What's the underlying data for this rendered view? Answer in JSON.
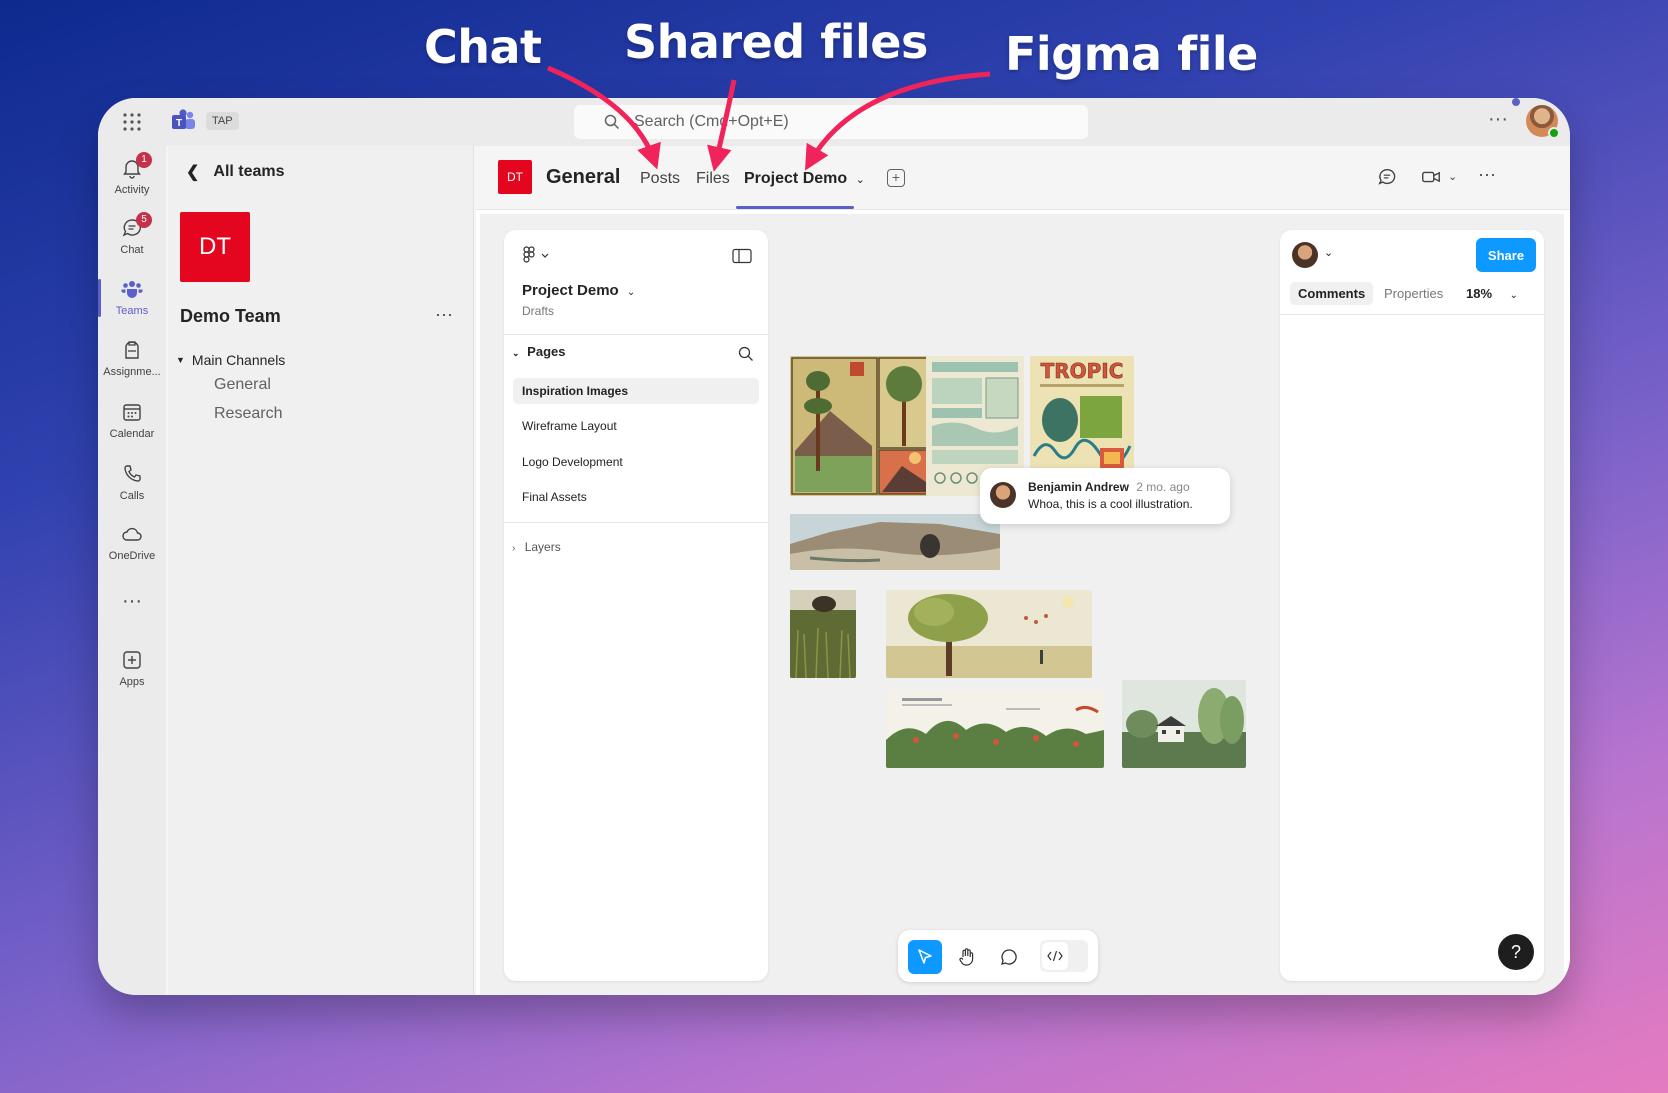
{
  "annotations": {
    "chat": "Chat",
    "shared_files": "Shared files",
    "figma_file": "Figma file"
  },
  "topbar": {
    "tenant": "TAP",
    "search_placeholder": "Search (Cmd+Opt+E)"
  },
  "rail": {
    "items": [
      {
        "label": "Activity",
        "badge": "1",
        "icon": "bell-icon"
      },
      {
        "label": "Chat",
        "badge": "5",
        "icon": "chat-icon"
      },
      {
        "label": "Teams",
        "icon": "teams-icon"
      },
      {
        "label": "Assignme...",
        "icon": "backpack-icon"
      },
      {
        "label": "Calendar",
        "icon": "calendar-icon"
      },
      {
        "label": "Calls",
        "icon": "phone-icon"
      },
      {
        "label": "OneDrive",
        "icon": "cloud-icon"
      },
      {
        "label": "Apps",
        "icon": "apps-icon"
      }
    ]
  },
  "team_panel": {
    "back_label": "All teams",
    "avatar_initials": "DT",
    "team_name": "Demo Team",
    "section": "Main Channels",
    "channels": [
      "General",
      "Research"
    ]
  },
  "channel_header": {
    "avatar_initials": "DT",
    "title": "General",
    "tabs": [
      "Posts",
      "Files",
      "Project Demo"
    ]
  },
  "figma": {
    "file_name": "Project Demo",
    "location": "Drafts",
    "pages_label": "Pages",
    "pages": [
      "Inspiration Images",
      "Wireframe Layout",
      "Logo Development",
      "Final Assets"
    ],
    "layers_label": "Layers",
    "share_label": "Share",
    "right_tabs": [
      "Comments",
      "Properties"
    ],
    "zoom": "18%",
    "poster_title": "TROPIC",
    "comment": {
      "author": "Benjamin Andrew",
      "time": "2 mo. ago",
      "text": "Whoa, this is a cool illustration."
    },
    "help": "?"
  },
  "colors": {
    "teams_accent": "#5b5fc7",
    "team_red": "#e3061e",
    "figma_blue": "#0d99ff",
    "badge_red": "#c4314b"
  }
}
